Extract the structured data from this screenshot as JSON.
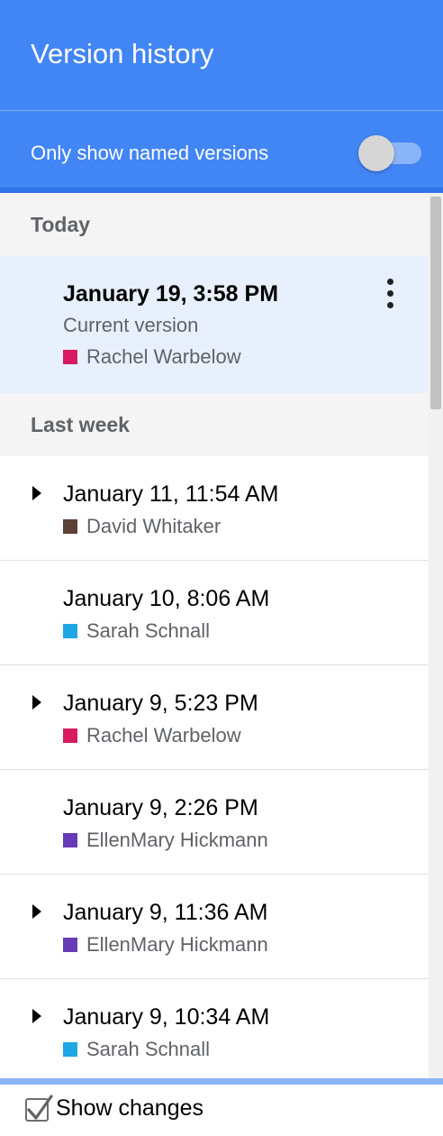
{
  "header": {
    "title": "Version history",
    "filter_label": "Only show named versions",
    "toggle_on": false
  },
  "sections": [
    {
      "label": "Today",
      "items": [
        {
          "date": "January 19, 3:58 PM",
          "subtitle": "Current version",
          "author": "Rachel Warbelow",
          "color": "#d81b60",
          "expandable": false,
          "current": true
        }
      ]
    },
    {
      "label": "Last week",
      "items": [
        {
          "date": "January 11, 11:54 AM",
          "author": "David Whitaker",
          "color": "#5d4037",
          "expandable": true
        },
        {
          "date": "January 10, 8:06 AM",
          "author": "Sarah Schnall",
          "color": "#1ea7e4",
          "expandable": false
        },
        {
          "date": "January 9, 5:23 PM",
          "author": "Rachel Warbelow",
          "color": "#d81b60",
          "expandable": true
        },
        {
          "date": "January 9, 2:26 PM",
          "author": "EllenMary Hickmann",
          "color": "#673ab7",
          "expandable": false
        },
        {
          "date": "January 9, 11:36 AM",
          "author": "EllenMary Hickmann",
          "color": "#673ab7",
          "expandable": true
        },
        {
          "date": "January 9, 10:34 AM",
          "author": "Sarah Schnall",
          "color": "#1ea7e4",
          "expandable": true
        }
      ]
    }
  ],
  "footer": {
    "show_changes_label": "Show changes",
    "show_changes_checked": true
  },
  "icons": {
    "more": "more-vert-icon",
    "expand": "triangle-right-icon",
    "check": "check-icon"
  }
}
